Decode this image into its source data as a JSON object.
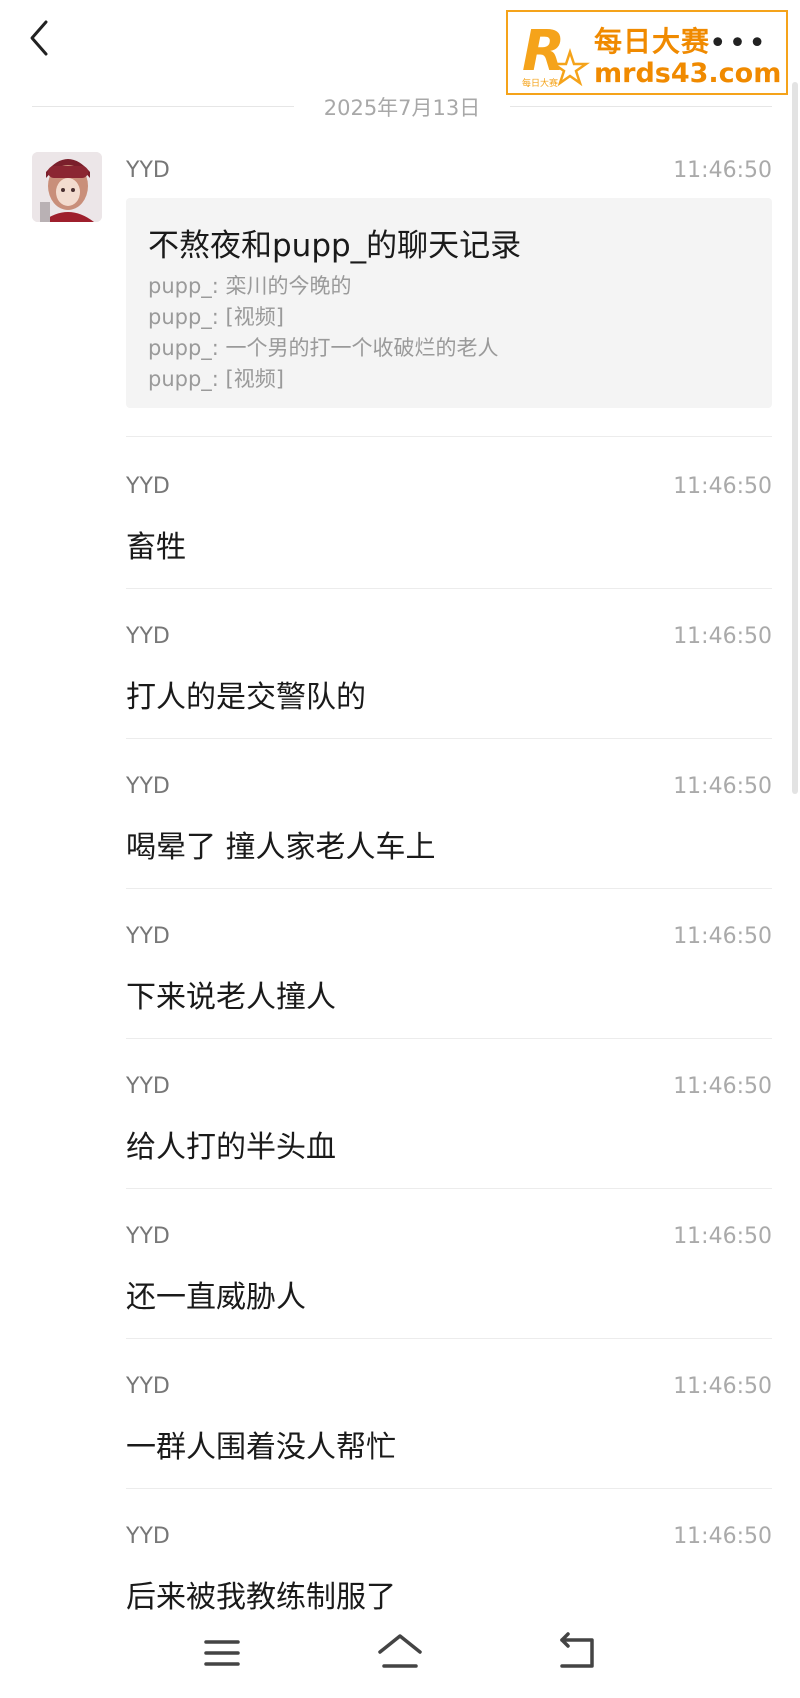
{
  "watermark": {
    "title": "每日大赛",
    "url": "mrds43.com",
    "logo_letter": "R",
    "logo_sub": "每日大赛"
  },
  "header": {
    "more_label": "•••"
  },
  "date_label": "2025年7月13日",
  "colors": {
    "accent": "#f08a00",
    "divider": "#ececec",
    "card_bg": "#f4f4f4"
  },
  "messages": [
    {
      "sender": "YYD",
      "time": "11:46:50",
      "record": {
        "title": "不熬夜和pupp_的聊天记录",
        "lines": [
          "pupp_: 栾川的今晚的",
          "pupp_: [视频]",
          "pupp_: 一个男的打一个收破烂的老人",
          "pupp_: [视频]"
        ]
      }
    },
    {
      "sender": "YYD",
      "time": "11:46:50",
      "text": "畜牲"
    },
    {
      "sender": "YYD",
      "time": "11:46:50",
      "text": "打人的是交警队的"
    },
    {
      "sender": "YYD",
      "time": "11:46:50",
      "text": "喝晕了 撞人家老人车上"
    },
    {
      "sender": "YYD",
      "time": "11:46:50",
      "text": "下来说老人撞人"
    },
    {
      "sender": "YYD",
      "time": "11:46:50",
      "text": "给人打的半头血"
    },
    {
      "sender": "YYD",
      "time": "11:46:50",
      "text": "还一直威胁人"
    },
    {
      "sender": "YYD",
      "time": "11:46:50",
      "text": "一群人围着没人帮忙"
    },
    {
      "sender": "YYD",
      "time": "11:46:50",
      "text": "后来被我教练制服了"
    }
  ],
  "icons": {
    "back": "chevron-left-icon",
    "more": "more-icon",
    "menu": "menu-icon",
    "home": "home-icon",
    "back_nav": "return-icon"
  }
}
